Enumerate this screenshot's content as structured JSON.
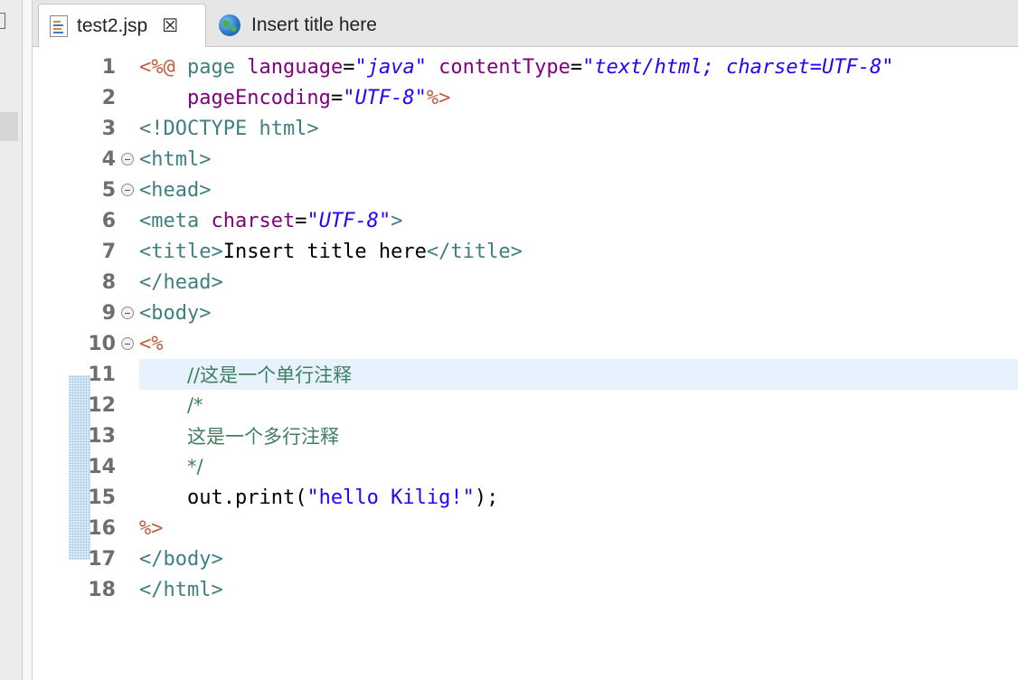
{
  "tabs": [
    {
      "label": "test2.jsp",
      "icon": "jsp-file-icon",
      "active": true
    },
    {
      "label": "Insert title here",
      "icon": "globe-icon",
      "active": false
    }
  ],
  "editor": {
    "lines": [
      {
        "n": "1"
      },
      {
        "n": "2"
      },
      {
        "n": "3"
      },
      {
        "n": "4"
      },
      {
        "n": "5"
      },
      {
        "n": "6"
      },
      {
        "n": "7"
      },
      {
        "n": "8"
      },
      {
        "n": "9"
      },
      {
        "n": "10"
      },
      {
        "n": "11"
      },
      {
        "n": "12"
      },
      {
        "n": "13"
      },
      {
        "n": "14"
      },
      {
        "n": "15"
      },
      {
        "n": "16"
      },
      {
        "n": "17"
      },
      {
        "n": "18"
      }
    ],
    "tokens": {
      "l1_open": "<%@",
      "l1_page": " page ",
      "l1_lang_attr": "language",
      "l1_eq": "=",
      "l1_q": "\"",
      "l1_lang_val": "java",
      "l1_ct_attr": " contentType",
      "l1_ct_val": "text/html; charset=UTF-8",
      "l2_indent": "    ",
      "l2_pe_attr": "pageEncoding",
      "l2_pe_val": "UTF-8",
      "l2_close": "%>",
      "l3": "<!DOCTYPE html>",
      "l4": "<html>",
      "l5": "<head>",
      "l6_open": "<meta",
      "l6_attr": " charset",
      "l6_val": "UTF-8",
      "l6_close": ">",
      "l7_open": "<title>",
      "l7_text": "Insert title here",
      "l7_close": "</title>",
      "l8": "</head>",
      "l9": "<body>",
      "l10": "<%",
      "l11": "//这是一个单行注释",
      "l12": "/*",
      "l13": "这是一个多行注释",
      "l14": "*/",
      "l15_a": "out.print(",
      "l15_s": "\"hello Kilig!\"",
      "l15_b": ");",
      "l16": "%>",
      "l17": "</body>",
      "l18": "</html>"
    }
  },
  "colors": {
    "tag": "#3f7f7f",
    "delimiter": "#bf5f3f",
    "attribute": "#7f007f",
    "value": "#2a00ff",
    "comment": "#3f7f5f",
    "current_line": "#e8f2fe"
  }
}
